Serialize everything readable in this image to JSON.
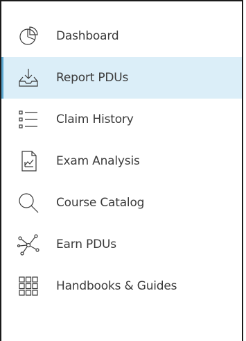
{
  "sidebar": {
    "accent_color": "#5aa6cf",
    "active_background": "#dbeef8",
    "active_index": 1,
    "items": [
      {
        "label": "Dashboard",
        "icon": "pie-chart-icon"
      },
      {
        "label": "Report PDUs",
        "icon": "tray-download-icon"
      },
      {
        "label": "Claim History",
        "icon": "checklist-icon"
      },
      {
        "label": "Exam Analysis",
        "icon": "document-chart-icon"
      },
      {
        "label": "Course Catalog",
        "icon": "search-icon"
      },
      {
        "label": "Earn PDUs",
        "icon": "network-icon"
      },
      {
        "label": "Handbooks & Guides",
        "icon": "grid-icon"
      }
    ]
  }
}
